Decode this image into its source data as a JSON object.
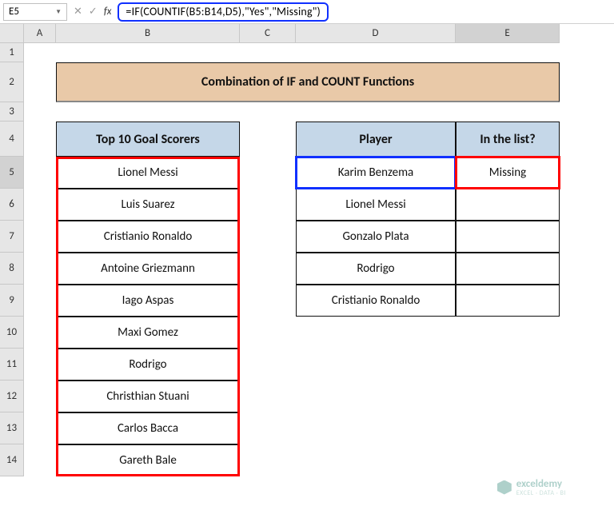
{
  "namebox": {
    "value": "E5"
  },
  "formula": "=IF(COUNTIF(B5:B14,D5),\"Yes\",\"Missing\")",
  "columns": [
    "A",
    "B",
    "C",
    "D",
    "E"
  ],
  "rows": [
    "1",
    "2",
    "3",
    "4",
    "5",
    "6",
    "7",
    "8",
    "9",
    "10",
    "11",
    "12",
    "13",
    "14"
  ],
  "selected_col": "E",
  "selected_row": "5",
  "title": "Combination of IF and COUNT Functions",
  "left_table": {
    "header": "Top 10 Goal Scorers",
    "rows": [
      "Lionel Messi",
      "Luis Suarez",
      "Cristianio Ronaldo",
      "Antoine Griezmann",
      "Iago Aspas",
      "Maxi Gomez",
      "Rodrigo",
      "Christhian Stuani",
      "Carlos Bacca",
      "Gareth Bale"
    ]
  },
  "right_table": {
    "headers": {
      "player": "Player",
      "inlist": "In the list?"
    },
    "rows": [
      {
        "player": "Karim Benzema",
        "inlist": "Missing"
      },
      {
        "player": "Lionel Messi",
        "inlist": ""
      },
      {
        "player": "Gonzalo Plata",
        "inlist": ""
      },
      {
        "player": "Rodrigo",
        "inlist": ""
      },
      {
        "player": "Cristianio Ronaldo",
        "inlist": ""
      }
    ]
  },
  "watermark": {
    "brand": "exceldemy",
    "tag": "EXCEL · DATA · BI"
  }
}
